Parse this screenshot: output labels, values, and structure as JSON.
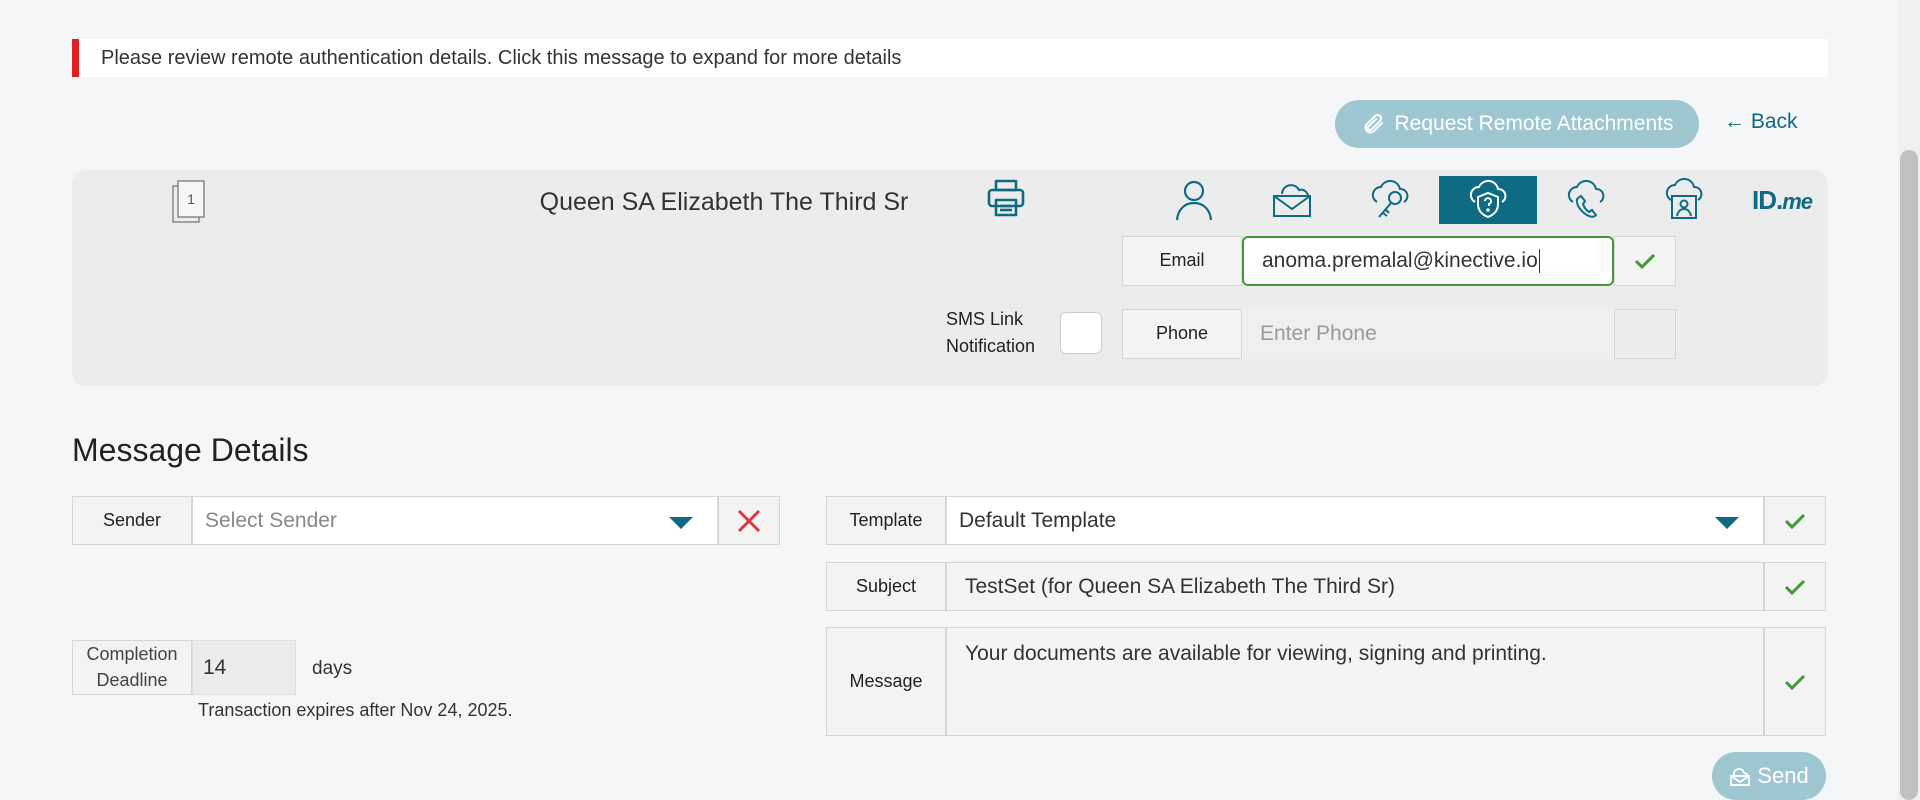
{
  "alert": {
    "text": "Please review remote authentication details. Click this message to expand for more details"
  },
  "actions": {
    "request_label": "Request Remote Attachments",
    "back_label": "← Back"
  },
  "recipient": {
    "doc_count": "1",
    "name": "Queen SA Elizabeth The Third Sr",
    "auth_methods": [
      {
        "icon": "person-icon",
        "active": false
      },
      {
        "icon": "email-icon",
        "active": false
      },
      {
        "icon": "key-cloud-icon",
        "active": false
      },
      {
        "icon": "shield-question-icon",
        "active": true
      },
      {
        "icon": "phone-cloud-icon",
        "active": false
      },
      {
        "icon": "id-card-cloud-icon",
        "active": false
      },
      {
        "icon": "idme-logo",
        "active": false
      }
    ],
    "idme_text_a": "ID.",
    "idme_text_b": "me",
    "email": {
      "label": "Email",
      "value": "anoma.premalal@kinective.io"
    },
    "sms": {
      "label_line1": "SMS Link",
      "label_line2": "Notification",
      "checked": false
    },
    "phone": {
      "label": "Phone",
      "placeholder": "Enter Phone"
    }
  },
  "message_details": {
    "title": "Message Details",
    "sender": {
      "label": "Sender",
      "placeholder": "Select Sender"
    },
    "template": {
      "label": "Template",
      "value": "Default Template"
    },
    "subject": {
      "label": "Subject",
      "value": "TestSet (for Queen SA Elizabeth The Third Sr)"
    },
    "message": {
      "label": "Message",
      "value": "Your documents are available for viewing, signing and printing."
    },
    "deadline": {
      "label_line1": "Completion",
      "label_line2": "Deadline",
      "value": "14",
      "unit": "days"
    },
    "expiry": "Transaction expires after Nov 24, 2025.",
    "send_label": "Send"
  },
  "colors": {
    "accent": "#0e6b82",
    "success": "#3f9a34",
    "danger": "#d9363e",
    "alert_bar": "#e02020",
    "button_disabled": "#9ec7d1"
  }
}
